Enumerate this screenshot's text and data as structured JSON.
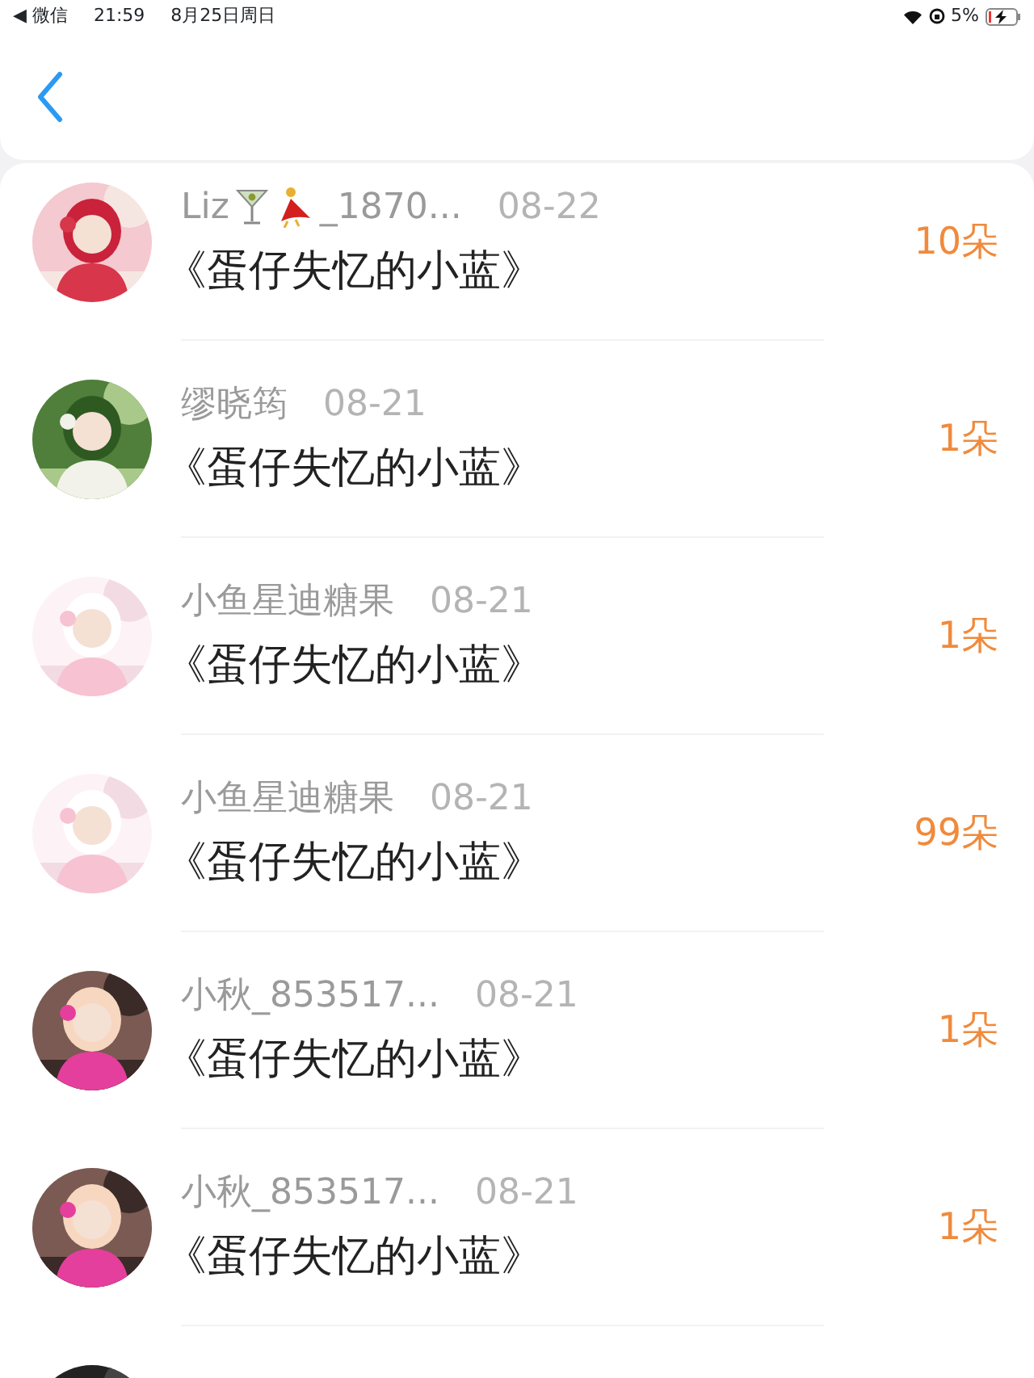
{
  "status_bar": {
    "back_app": "◀ 微信",
    "time": "21:59",
    "date": "8月25日周日",
    "battery": "5%"
  },
  "rows": [
    {
      "kind": "emoji-name",
      "name": "Liz",
      "name_suffix": "_1870...",
      "date": "08-22",
      "title": "《蛋仔失忆的小蓝》",
      "count": "10朵"
    },
    {
      "kind": "plain",
      "name": "缪晓筠",
      "date": "08-21",
      "title": "《蛋仔失忆的小蓝》",
      "count": "1朵"
    },
    {
      "kind": "plain",
      "name": "小鱼星迪糖果",
      "date": "08-21",
      "title": "《蛋仔失忆的小蓝》",
      "count": "1朵"
    },
    {
      "kind": "plain",
      "name": "小鱼星迪糖果",
      "date": "08-21",
      "title": "《蛋仔失忆的小蓝》",
      "count": "99朵"
    },
    {
      "kind": "plain",
      "name": "小秋_853517...",
      "date": "08-21",
      "title": "《蛋仔失忆的小蓝》",
      "count": "1朵"
    },
    {
      "kind": "plain",
      "name": "小秋_853517...",
      "date": "08-21",
      "title": "《蛋仔失忆的小蓝》",
      "count": "1朵"
    },
    {
      "kind": "cut"
    }
  ]
}
